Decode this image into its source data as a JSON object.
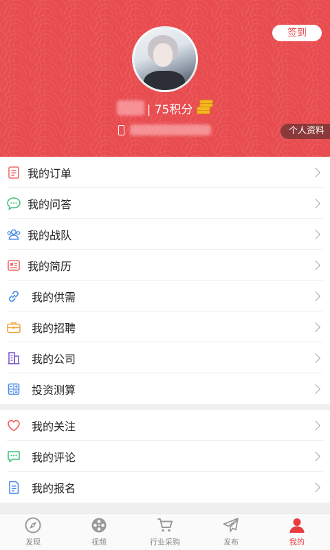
{
  "header": {
    "checkin_label": "签到",
    "points_text": "| 75积分",
    "profile_label": "个人资料"
  },
  "menu_group_1": [
    {
      "label": "我的订单",
      "icon": "order-icon"
    },
    {
      "label": "我的问答",
      "icon": "chat-icon"
    },
    {
      "label": "我的战队",
      "icon": "team-icon"
    },
    {
      "label": "我的简历",
      "icon": "resume-icon"
    },
    {
      "label": "我的供需",
      "icon": "link-icon"
    },
    {
      "label": "我的招聘",
      "icon": "briefcase-icon"
    },
    {
      "label": "我的公司",
      "icon": "building-icon"
    },
    {
      "label": "投资测算",
      "icon": "calculator-icon"
    }
  ],
  "menu_group_2": [
    {
      "label": "我的关注",
      "icon": "heart-icon"
    },
    {
      "label": "我的评论",
      "icon": "comment-icon"
    },
    {
      "label": "我的报名",
      "icon": "signup-icon"
    }
  ],
  "tabbar": [
    {
      "label": "发现",
      "icon": "discover-icon",
      "active": false
    },
    {
      "label": "视频",
      "icon": "film-reel-icon",
      "active": false
    },
    {
      "label": "行业采购",
      "icon": "cart-icon",
      "active": false
    },
    {
      "label": "发布",
      "icon": "paper-plane-icon",
      "active": false
    },
    {
      "label": "我的",
      "icon": "user-icon",
      "active": true
    }
  ],
  "colors": {
    "accent": "#e84c4f",
    "active_tab": "#e83b3e"
  }
}
